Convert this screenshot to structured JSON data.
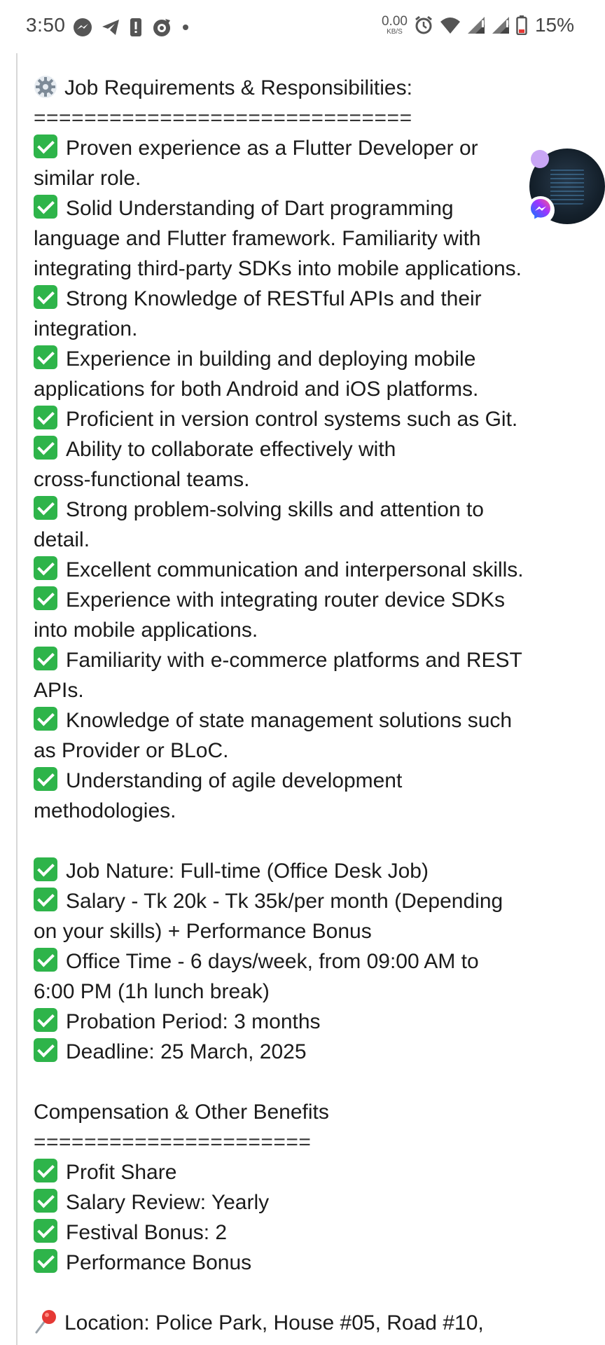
{
  "status_bar": {
    "time": "3:50",
    "net_speed_value": "0.00",
    "net_speed_unit": "KB/S",
    "battery": "15%",
    "left_icons": [
      "messenger-icon",
      "telegram-icon",
      "alert-icon",
      "app-icon",
      "more-dot-icon"
    ],
    "right_icons": [
      "alarm-icon",
      "wifi-icon",
      "signal-icon",
      "signal-icon",
      "battery-icon"
    ]
  },
  "post": {
    "requirements_heading": "Job Requirements & Responsibilities:",
    "requirements_separator": "==============================",
    "requirements": [
      [
        "Proven experience as a Flutter Developer or",
        "similar role."
      ],
      [
        "Solid Understanding of Dart programming",
        "language and Flutter framework. Familiarity with",
        "integrating third-party SDKs into mobile applications."
      ],
      [
        "Strong Knowledge of RESTful APIs and their",
        "integration."
      ],
      [
        "Experience in building and deploying mobile",
        "applications for both Android and iOS platforms."
      ],
      [
        "Proficient in version control systems such as Git."
      ],
      [
        "Ability to collaborate effectively with",
        "cross-functional teams."
      ],
      [
        "Strong problem-solving skills and attention to",
        "detail."
      ],
      [
        "Excellent communication and interpersonal skills."
      ],
      [
        "Experience with integrating router device SDKs",
        "into mobile applications."
      ],
      [
        "Familiarity with e-commerce platforms and REST",
        "APIs."
      ],
      [
        "Knowledge of state management solutions such",
        "as Provider or BLoC."
      ],
      [
        "Understanding of agile development",
        "methodologies."
      ]
    ],
    "job_details": [
      [
        "Job Nature: Full-time (Office Desk Job)"
      ],
      [
        "Salary - Tk 20k - Tk 35k/per month (Depending",
        "on your skills) + Performance Bonus"
      ],
      [
        "Office Time - 6 days/week, from 09:00 AM to",
        "6:00 PM (1h lunch break)"
      ],
      [
        "Probation Period: 3 months"
      ],
      [
        "Deadline: 25 March, 2025"
      ]
    ],
    "benefits_heading": "Compensation & Other Benefits",
    "benefits_separator": "======================",
    "benefits": [
      [
        "Profit Share"
      ],
      [
        "Salary Review: Yearly"
      ],
      [
        "Festival Bonus: 2"
      ],
      [
        "Performance Bonus"
      ]
    ],
    "location": "Location: Police Park, House #05, Road #10,"
  },
  "chat_head": {
    "badge_icon": "messenger-icon",
    "dot_color": "#c9a6f5"
  },
  "colors": {
    "check_green": "#2eb44a",
    "text": "#1b1b1b"
  }
}
